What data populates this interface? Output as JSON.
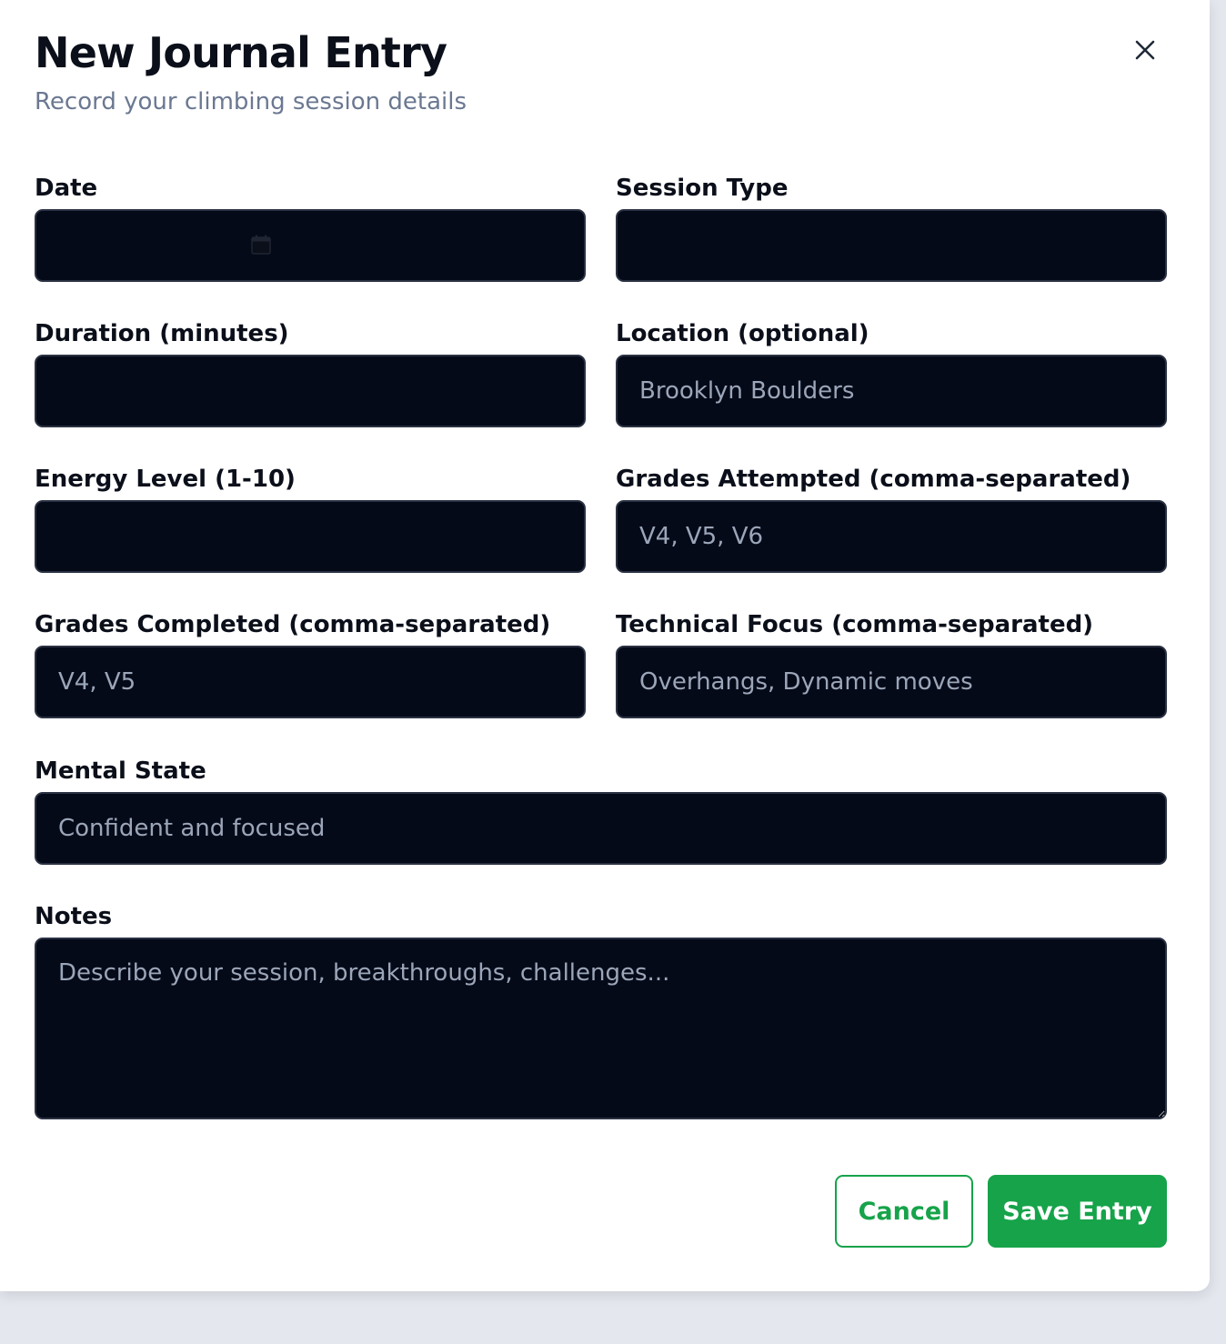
{
  "dialog": {
    "title": "New Journal Entry",
    "subtitle": "Record your climbing session details",
    "close_icon": "close-icon"
  },
  "fields": {
    "date": {
      "label": "Date",
      "value": "",
      "icon": "calendar-icon"
    },
    "session_type": {
      "label": "Session Type",
      "value": ""
    },
    "duration": {
      "label": "Duration (minutes)",
      "value": ""
    },
    "location": {
      "label": "Location (optional)",
      "placeholder": "Brooklyn Boulders"
    },
    "energy": {
      "label": "Energy Level (1-10)",
      "value": ""
    },
    "grades_attempted": {
      "label": "Grades Attempted (comma-separated)",
      "placeholder": "V4, V5, V6"
    },
    "grades_completed": {
      "label": "Grades Completed (comma-separated)",
      "placeholder": "V4, V5"
    },
    "technical_focus": {
      "label": "Technical Focus (comma-separated)",
      "placeholder": "Overhangs, Dynamic moves"
    },
    "mental_state": {
      "label": "Mental State",
      "placeholder": "Confident and focused"
    },
    "notes": {
      "label": "Notes",
      "placeholder": "Describe your session, breakthroughs, challenges..."
    }
  },
  "actions": {
    "cancel_label": "Cancel",
    "save_label": "Save Entry"
  },
  "colors": {
    "accent": "#16a34a",
    "input_bg": "#050a19",
    "placeholder": "#9ba6b8",
    "subtitle": "#6b7891"
  }
}
